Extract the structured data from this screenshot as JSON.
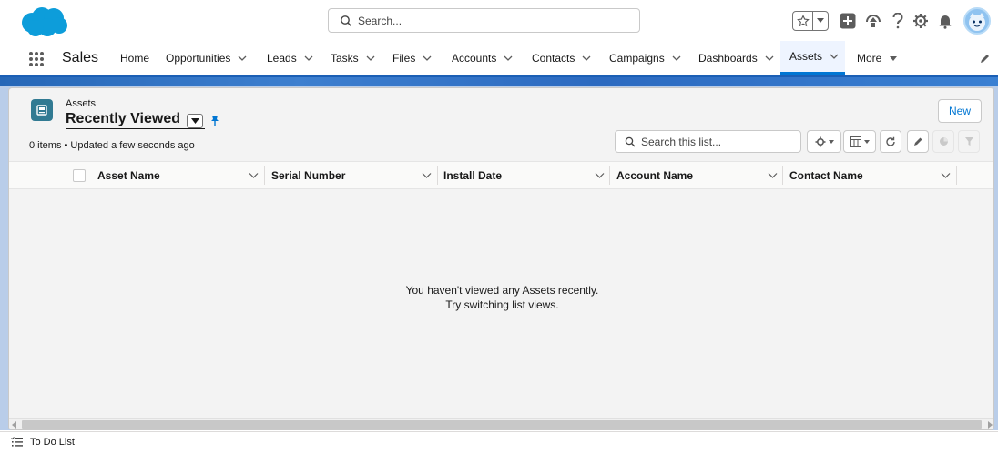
{
  "header": {
    "search_placeholder": "Search...",
    "icons": [
      "salesforce-logo",
      "favorites-star",
      "favorites-dropdown",
      "global-actions-plus",
      "trailhead",
      "help",
      "setup-gear",
      "notifications-bell",
      "user-avatar"
    ]
  },
  "nav": {
    "app_name": "Sales",
    "items": [
      {
        "label": "Home",
        "has_menu": false
      },
      {
        "label": "Opportunities",
        "has_menu": true
      },
      {
        "label": "Leads",
        "has_menu": true
      },
      {
        "label": "Tasks",
        "has_menu": true
      },
      {
        "label": "Files",
        "has_menu": true
      },
      {
        "label": "Accounts",
        "has_menu": true
      },
      {
        "label": "Contacts",
        "has_menu": true
      },
      {
        "label": "Campaigns",
        "has_menu": true
      },
      {
        "label": "Dashboards",
        "has_menu": true
      },
      {
        "label": "Assets",
        "has_menu": true,
        "active": true
      },
      {
        "label": "More",
        "has_menu": true
      }
    ]
  },
  "list_view": {
    "object_label": "Assets",
    "title": "Recently Viewed",
    "new_button": "New",
    "meta": "0 items • Updated a few seconds ago",
    "search_placeholder": "Search this list...",
    "columns": [
      "Asset Name",
      "Serial Number",
      "Install Date",
      "Account Name",
      "Contact Name"
    ],
    "rows": [],
    "empty_line1": "You haven't viewed any Assets recently.",
    "empty_line2": "Try switching list views."
  },
  "utility_bar": {
    "item": "To Do List"
  },
  "colors": {
    "brand_blue": "#0176d3",
    "banner_blue": "#2667b7",
    "asset_icon": "#317a92"
  }
}
